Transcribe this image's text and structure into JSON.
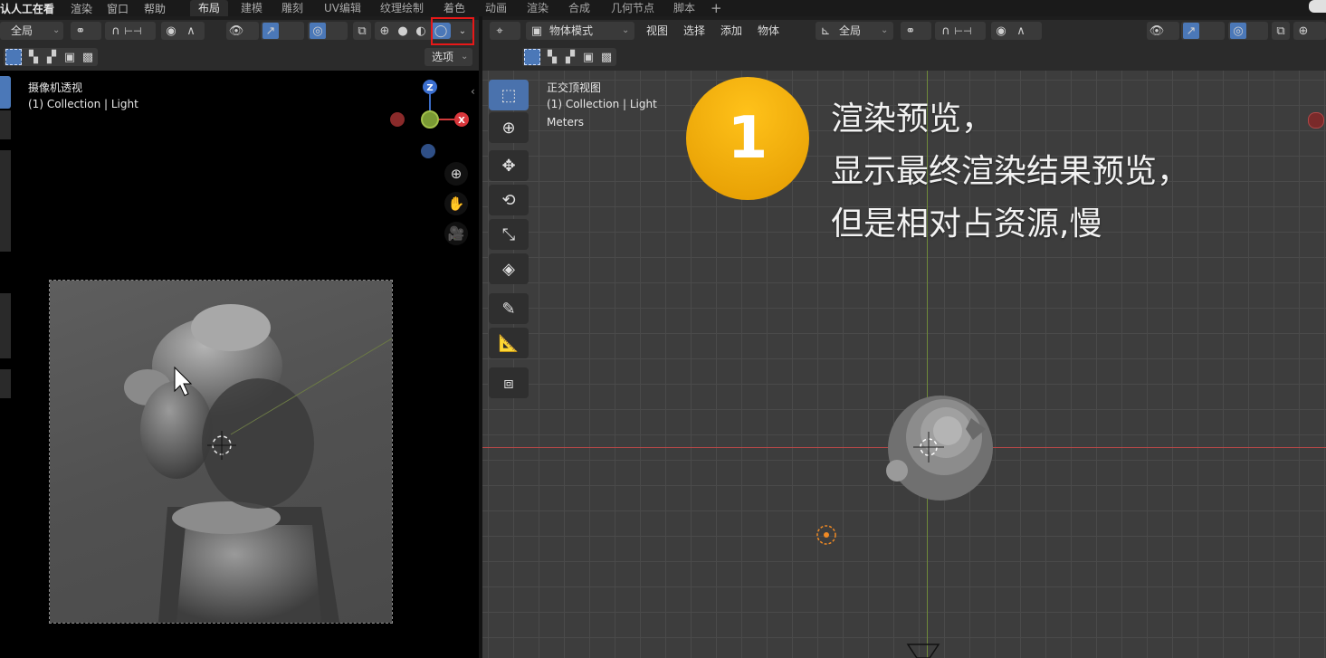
{
  "top_menu": {
    "items": [
      "认人工在看",
      "渲染",
      "窗口",
      "帮助"
    ],
    "workspace_tabs": [
      "布局",
      "建模",
      "雕刻",
      "UV编辑",
      "纹理绘制",
      "着色",
      "动画",
      "渲染",
      "合成",
      "几何节点",
      "脚本"
    ],
    "add_tab_glyph": "+",
    "active_tab": "布局"
  },
  "left_header": {
    "transform_orientation": "全局",
    "select_options": "选项",
    "highlight_color": "#e81818"
  },
  "left_viewport": {
    "view_name": "摄像机透视",
    "collection_label": "(1) Collection | Light",
    "gizmo": {
      "z": "Z",
      "x": "X"
    }
  },
  "right_header": {
    "mode": "物体模式",
    "menus": [
      "视图",
      "选择",
      "添加",
      "物体"
    ],
    "transform_orientation": "全局"
  },
  "right_viewport": {
    "view_name": "正交顶视图",
    "collection_label": "(1) Collection | Light",
    "units": "Meters"
  },
  "callout": {
    "number": "1",
    "lines": [
      "渲染预览，",
      "显示最终渲染结果预览，",
      "但是相对占资源,慢"
    ],
    "badge_color": "#f1a400"
  },
  "icons": [
    "cursor-arrow-icon",
    "select-box-icon",
    "cursor-icon",
    "move-icon",
    "rotate-icon",
    "scale-icon",
    "transform-icon",
    "annotate-icon",
    "measure-icon",
    "add-cube-icon",
    "zoom-icon",
    "hand-icon",
    "camera-icon"
  ]
}
